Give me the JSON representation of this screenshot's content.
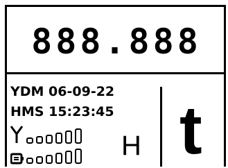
{
  "display": {
    "reading": "888.888",
    "date_line": "YDM 06-09-22",
    "time_line": "HMS 15:23:45",
    "mode_letter": "H",
    "unit_letter": "t"
  },
  "indicators": {
    "signal_icon": "antenna-signal-icon",
    "signal_level": 0,
    "signal_max": 6,
    "battery_icon": "battery-icon",
    "battery_level": 0,
    "battery_max": 6
  }
}
